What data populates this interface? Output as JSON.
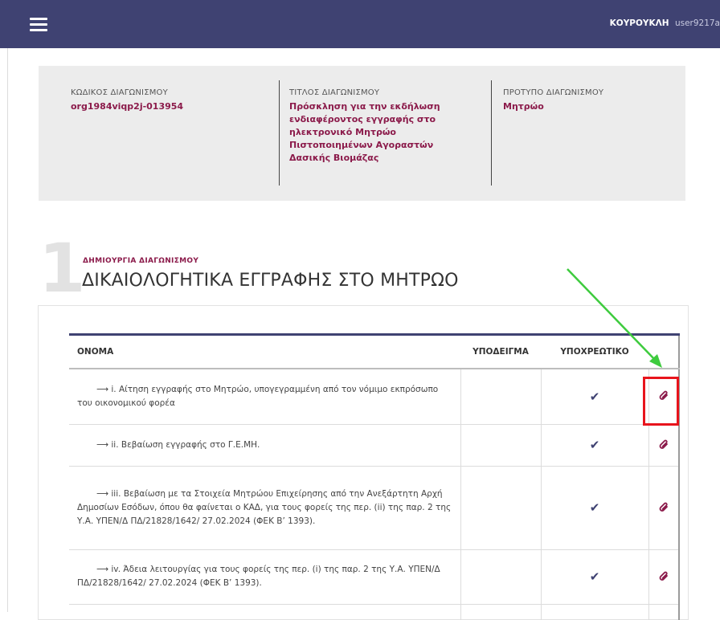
{
  "header": {
    "user_name": "ΚΟΥΡΟΥΚΛΗ",
    "user_id": "user9217a"
  },
  "info": {
    "code_label": "ΚΩΔΙΚΟΣ ΔΙΑΓΩΝΙΣΜΟΥ",
    "code_value": "org1984viqp2j-013954",
    "title_label": "ΤΙΤΛΟΣ ΔΙΑΓΩΝΙΣΜΟΥ",
    "title_value": "Πρόσκληση για την εκδήλωση ενδιαφέροντος εγγραφής στο ηλεκτρονικό Μητρώο Πιστοποιημένων Αγοραστών Δασικής Βιομάζας",
    "template_label": "ΠΡΟΤΥΠΟ ΔΙΑΓΩΝΙΣΜΟΥ",
    "template_value": "Μητρώο"
  },
  "section": {
    "number": "1",
    "subtitle": "ΔΗΜΙΟΥΡΓΙΑ ΔΙΑΓΩΝΙΣΜΟΥ",
    "title": "ΔΙΚΑΙΟΛΟΓΗΤΙΚΑ ΕΓΓΡΑΦΗΣ ΣΤΟ ΜΗΤΡΩΟ"
  },
  "table": {
    "headers": {
      "name": "ΟΝΟΜΑ",
      "sample": "ΥΠΟΔΕΙΓΜΑ",
      "mandatory": "ΥΠΟΧΡΕΩΤΙΚΟ"
    },
    "rows": [
      {
        "name": "i. Αίτηση εγγραφής στο Μητρώο, υπογεγραμμένη από τον νόμιμο εκπρόσωπο του οικονομικού φορέα",
        "mandatory": true
      },
      {
        "name": "ii. Βεβαίωση εγγραφής στο Γ.Ε.ΜΗ.",
        "mandatory": true
      },
      {
        "name": "iii. Βεβαίωση με τα Στοιχεία Μητρώου Επιχείρησης από την Ανεξάρτητη Αρχή Δημοσίων Εσόδων, όπου θα φαίνεται ο ΚΑΔ, για τους φορείς της περ. (ii) της παρ. 2 της Υ.Α. ΥΠΕΝ/Δ ΠΔ/21828/1642/ 27.02.2024 (ΦΕΚ Β’ 1393).",
        "mandatory": true
      },
      {
        "name": "iv. Άδεια λειτουργίας για τους φορείς της περ. (i) της παρ. 2 της Υ.Α. ΥΠΕΝ/Δ ΠΔ/21828/1642/ 27.02.2024 (ΦΕΚ Β’ 1393).",
        "mandatory": true
      }
    ]
  },
  "colors": {
    "topbar": "#3f4272",
    "accent": "#8b1a4a",
    "annotation_box": "#e8141c",
    "annotation_arrow": "#3ecb3e"
  },
  "icons": {
    "menu": "hamburger-menu-icon",
    "check": "checkmark-icon",
    "attach": "paperclip-icon"
  }
}
